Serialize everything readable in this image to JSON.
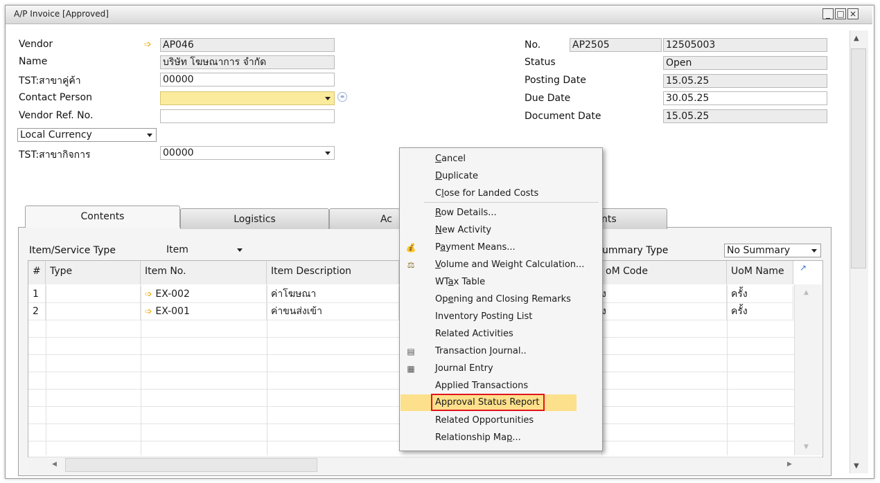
{
  "window": {
    "title": "A/P Invoice [Approved]",
    "min": "_",
    "max": "□",
    "close": "×"
  },
  "header_left": {
    "vendor_label": "Vendor",
    "vendor_value": "AP046",
    "name_label": "Name",
    "name_value": "บริษัท โฆษณาการ จำกัด",
    "tst_branch_label": "TST:สาขาคู่ค้า",
    "tst_branch_value": "00000",
    "contact_label": "Contact Person",
    "contact_value": "",
    "vendor_ref_label": "Vendor Ref. No.",
    "vendor_ref_value": "",
    "currency_value": "Local Currency",
    "tst_biz_label": "TST:สาขากิจการ",
    "tst_biz_value": "00000"
  },
  "header_right": {
    "no_label": "No.",
    "no_series": "AP2505",
    "no_value": "12505003",
    "status_label": "Status",
    "status_value": "Open",
    "posting_label": "Posting Date",
    "posting_value": "15.05.25",
    "due_label": "Due Date",
    "due_value": "30.05.25",
    "doc_label": "Document Date",
    "doc_value": "15.05.25"
  },
  "tabs": [
    {
      "label": "Contents"
    },
    {
      "label": "Logistics"
    },
    {
      "label": "Ac"
    },
    {
      "label": "nts"
    }
  ],
  "contents": {
    "item_type_label": "Item/Service Type",
    "item_type_value": "Item",
    "summary_label": "ummary Type",
    "summary_value": "No Summary",
    "columns": [
      "#",
      "Type",
      "Item No.",
      "Item Description",
      "oM Code",
      "UoM Name"
    ],
    "rows": [
      {
        "num": "1",
        "type": "",
        "item_no": "EX-002",
        "desc": "ค่าโฆษณา",
        "uom_code": "ง",
        "uom_name": "ครั้ง"
      },
      {
        "num": "2",
        "type": "",
        "item_no": "EX-001",
        "desc": "ค่าขนส่งเข้า",
        "uom_code": "ง",
        "uom_name": "ครั้ง"
      }
    ]
  },
  "context_menu": {
    "items": [
      {
        "label": "Cancel",
        "u": "C",
        "rest": "ancel"
      },
      {
        "label": "Duplicate",
        "u": "D",
        "rest": "uplicate"
      },
      {
        "label": "Close for Landed Costs",
        "pre": "C",
        "u": "l",
        "rest": "ose for Landed Costs"
      },
      {
        "label": "Row Details...",
        "u": "R",
        "rest": "ow Details..."
      },
      {
        "label": "New Activity",
        "u": "N",
        "rest": "ew Activity"
      },
      {
        "label": "Payment Means...",
        "pre": "P",
        "u": "a",
        "rest": "yment Means..."
      },
      {
        "label": "Volume and Weight Calculation...",
        "u": "V",
        "rest": "olume and Weight Calculation..."
      },
      {
        "label": "WTax Table",
        "pre": "WT",
        "u": "a",
        "rest": "x Table"
      },
      {
        "label": "Opening and Closing Remarks",
        "pre": "Op",
        "u": "e",
        "rest": "ning and Closing Remarks"
      },
      {
        "label": "Inventory Posting List"
      },
      {
        "label": "Related Activities"
      },
      {
        "label": "Transaction Journal..",
        "pre": "Transaction ",
        "u": "J",
        "rest": "ournal.."
      },
      {
        "label": "Journal Entry"
      },
      {
        "label": "Applied Transactions"
      },
      {
        "label": "Approval Status Report"
      },
      {
        "label": "Related Opportunities"
      },
      {
        "label": "Relationship Map...",
        "pre": "Relationship Ma",
        "u": "p",
        "rest": "..."
      }
    ]
  },
  "colors": {
    "highlight": "#fde08b",
    "red_outline": "#e0141e",
    "yellow_field": "#fbeb9c"
  },
  "icons": [
    "link-arrow-icon",
    "payment-means-icon",
    "volume-weight-icon",
    "transaction-journal-icon",
    "journal-entry-icon"
  ]
}
